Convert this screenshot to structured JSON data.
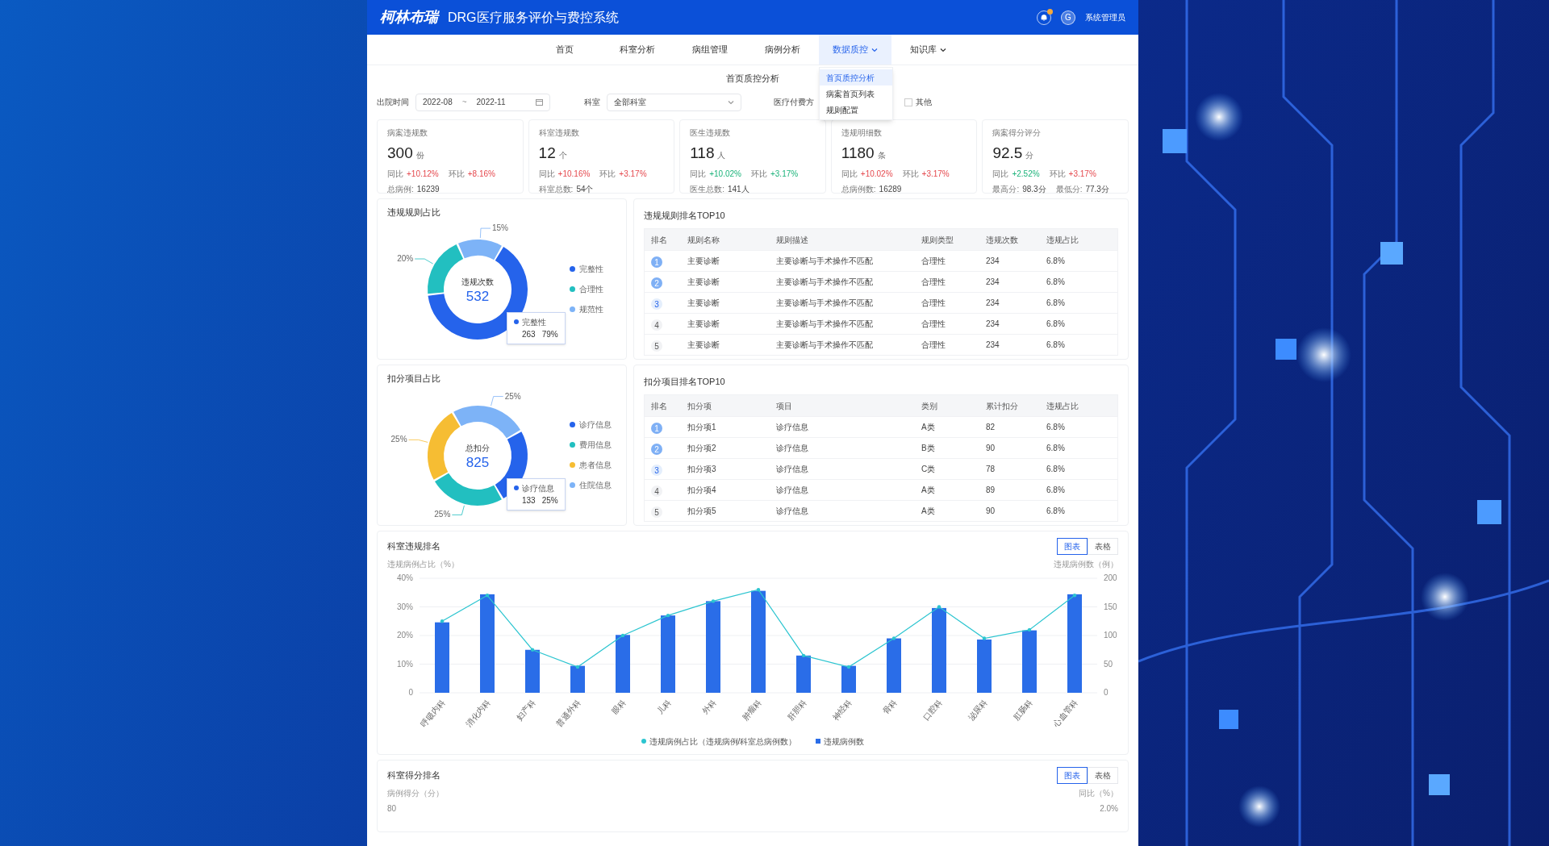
{
  "header": {
    "logo": "柯林布瑞",
    "title": "DRG医疗服务评价与费控系统",
    "avatar": "G",
    "user": "系统管理员"
  },
  "nav": [
    {
      "label": "首页",
      "selected": false,
      "has_menu": false
    },
    {
      "label": "科室分析",
      "selected": false,
      "has_menu": false
    },
    {
      "label": "病组管理",
      "selected": false,
      "has_menu": false
    },
    {
      "label": "病例分析",
      "selected": false,
      "has_menu": false
    },
    {
      "label": "数据质控",
      "selected": true,
      "has_menu": true
    },
    {
      "label": "知识库",
      "selected": false,
      "has_menu": true
    }
  ],
  "dropdown": [
    {
      "label": "首页质控分析",
      "selected": true
    },
    {
      "label": "病案首页列表",
      "selected": false
    },
    {
      "label": "规则配置",
      "selected": false
    }
  ],
  "page_title": "首页质控分析",
  "filters": {
    "date_label": "出院时间",
    "date_start": "2022-08",
    "date_sep": "~",
    "date_end": "2022-11",
    "dept_label": "科室",
    "dept_value": "全部科室",
    "payment_label": "医疗付费方",
    "other": {
      "label": "其他",
      "checked": false
    }
  },
  "stats": [
    {
      "title": "病案违规数",
      "value": "300",
      "unit": "份",
      "changes": [
        {
          "label": "同比",
          "value": "+10.12%",
          "color": "#e5484d"
        },
        {
          "label": "环比",
          "value": "+8.16%",
          "color": "#e5484d"
        }
      ],
      "footer": [
        {
          "label": "总病例:",
          "value": "16239"
        }
      ]
    },
    {
      "title": "科室违规数",
      "value": "12",
      "unit": "个",
      "changes": [
        {
          "label": "同比",
          "value": "+10.16%",
          "color": "#e5484d"
        },
        {
          "label": "环比",
          "value": "+3.17%",
          "color": "#e5484d"
        }
      ],
      "footer": [
        {
          "label": "科室总数:",
          "value": "54个"
        }
      ]
    },
    {
      "title": "医生违规数",
      "value": "118",
      "unit": "人",
      "changes": [
        {
          "label": "同比",
          "value": "+10.02%",
          "color": "#1bb37a"
        },
        {
          "label": "环比",
          "value": "+3.17%",
          "color": "#1bb37a"
        }
      ],
      "footer": [
        {
          "label": "医生总数:",
          "value": "141人"
        }
      ]
    },
    {
      "title": "违规明细数",
      "value": "1180",
      "unit": "条",
      "changes": [
        {
          "label": "同比",
          "value": "+10.02%",
          "color": "#e5484d"
        },
        {
          "label": "环比",
          "value": "+3.17%",
          "color": "#e5484d"
        }
      ],
      "footer": [
        {
          "label": "总病例数:",
          "value": "16289"
        }
      ]
    },
    {
      "title": "病案得分评分",
      "value": "92.5",
      "unit": "分",
      "changes": [
        {
          "label": "同比",
          "value": "+2.52%",
          "color": "#1bb37a"
        },
        {
          "label": "环比",
          "value": "+3.17%",
          "color": "#e5484d"
        }
      ],
      "footer": [
        {
          "label": "最高分:",
          "value": "98.3分"
        },
        {
          "label": "最低分:",
          "value": "77.3分"
        }
      ]
    }
  ],
  "sections": [
    {
      "donut": {
        "title": "违规规则占比",
        "center_value": "532",
        "chart_data": {
          "type": "donut",
          "series": [
            {
              "name": "违规次数",
              "values": [
                65,
                20,
                15
              ]
            }
          ],
          "value_labels": [
            null,
            "20%",
            "15%"
          ]
        },
        "legend": [
          {
            "label": "完整性",
            "color": "#2563eb"
          },
          {
            "label": "合理性",
            "color": "#22bfc0"
          },
          {
            "label": "规范性",
            "color": "#7db3f7"
          }
        ],
        "tooltip": {
          "name": "完整性",
          "color": "#2563eb",
          "count": "263",
          "share": "79%"
        }
      },
      "table": {
        "title": "违规规则排名TOP10",
        "columns": [
          "排名",
          "规则名称",
          "规则描述",
          "规则类型",
          "违规次数",
          "违规占比"
        ],
        "rows": [
          [
            "1",
            "主要诊断",
            "主要诊断与手术操作不匹配",
            "合理性",
            "234",
            "6.8%"
          ],
          [
            "2",
            "主要诊断",
            "主要诊断与手术操作不匹配",
            "合理性",
            "234",
            "6.8%"
          ],
          [
            "3",
            "主要诊断",
            "主要诊断与手术操作不匹配",
            "合理性",
            "234",
            "6.8%"
          ],
          [
            "4",
            "主要诊断",
            "主要诊断与手术操作不匹配",
            "合理性",
            "234",
            "6.8%"
          ],
          [
            "5",
            "主要诊断",
            "主要诊断与手术操作不匹配",
            "合理性",
            "234",
            "6.8%"
          ]
        ]
      }
    },
    {
      "donut": {
        "title": "扣分项目占比",
        "center_value": "825",
        "chart_data": {
          "type": "donut",
          "series": [
            {
              "name": "总扣分",
              "values": [
                25,
                25,
                25,
                25
              ]
            }
          ],
          "value_labels": [
            null,
            "25%",
            "25%",
            "25%"
          ]
        },
        "legend": [
          {
            "label": "诊疗信息",
            "color": "#2563eb"
          },
          {
            "label": "费用信息",
            "color": "#22bfc0"
          },
          {
            "label": "患者信息",
            "color": "#f6bd33"
          },
          {
            "label": "住院信息",
            "color": "#7db3f7"
          }
        ],
        "tooltip": {
          "name": "诊疗信息",
          "color": "#2563eb",
          "count": "133",
          "share": "25%"
        }
      },
      "table": {
        "title": "扣分项目排名TOP10",
        "columns": [
          "排名",
          "扣分项",
          "项目",
          "类别",
          "累计扣分",
          "违规占比"
        ],
        "rows": [
          [
            "1",
            "扣分项1",
            "诊疗信息",
            "A类",
            "82",
            "6.8%"
          ],
          [
            "2",
            "扣分项2",
            "诊疗信息",
            "B类",
            "90",
            "6.8%"
          ],
          [
            "3",
            "扣分项3",
            "诊疗信息",
            "C类",
            "78",
            "6.8%"
          ],
          [
            "4",
            "扣分项4",
            "诊疗信息",
            "A类",
            "89",
            "6.8%"
          ],
          [
            "5",
            "扣分项5",
            "诊疗信息",
            "A类",
            "90",
            "6.8%"
          ]
        ]
      }
    }
  ],
  "dept_chart": {
    "title": "科室违规排名",
    "toggle": [
      {
        "label": "图表",
        "selected": true
      },
      {
        "label": "表格",
        "selected": false
      }
    ],
    "bar_chart": {
      "chart_data": {
        "type": "bar",
        "ylabel": "违规病例数（例）",
        "categories": [
          "呼吸内科",
          "消化内科",
          "妇产科",
          "普通外科",
          "眼科",
          "儿科",
          "外科",
          "肿瘤科",
          "肝胆科",
          "神经科",
          "骨科",
          "口腔科",
          "泌尿科",
          "肛肠科",
          "心血管科"
        ],
        "series": [
          {
            "name": "违规病例数",
            "color": "#2a6de8",
            "values": [
              123,
              172,
              75,
              47,
              101,
              135,
              160,
              178,
              65,
              47,
              95,
              148,
              93,
              109,
              172
            ]
          }
        ],
        "ylim": [
          0,
          200
        ],
        "yticks": [
          0,
          50,
          100,
          150,
          200
        ],
        "grid": true
      }
    },
    "line_chart": {
      "chart_data": {
        "type": "line",
        "ylabel": "违规病例占比（%）",
        "series": [
          {
            "name": "违规病例占比（违规病例/科室总病例数）",
            "color": "#2cc5d0",
            "values": [
              25,
              34,
              15,
              9,
              20,
              27,
              32,
              36,
              13,
              9,
              19,
              30,
              19,
              22,
              34
            ]
          }
        ],
        "ylim": [
          0,
          40
        ],
        "yticks": [
          {
            "value": 0,
            "label": "0"
          },
          {
            "value": 10,
            "label": "10%"
          },
          {
            "value": 20,
            "label": "20%"
          },
          {
            "value": 30,
            "label": "30%"
          },
          {
            "value": 40,
            "label": "40%"
          }
        ]
      }
    }
  },
  "score_chart": {
    "title": "科室得分排名",
    "toggle": [
      {
        "label": "图表",
        "selected": true
      },
      {
        "label": "表格",
        "selected": false
      }
    ],
    "left_label": "病例得分（分）",
    "right_label": "同比（%）",
    "left_tick": "80",
    "right_tick": "2.0%"
  }
}
